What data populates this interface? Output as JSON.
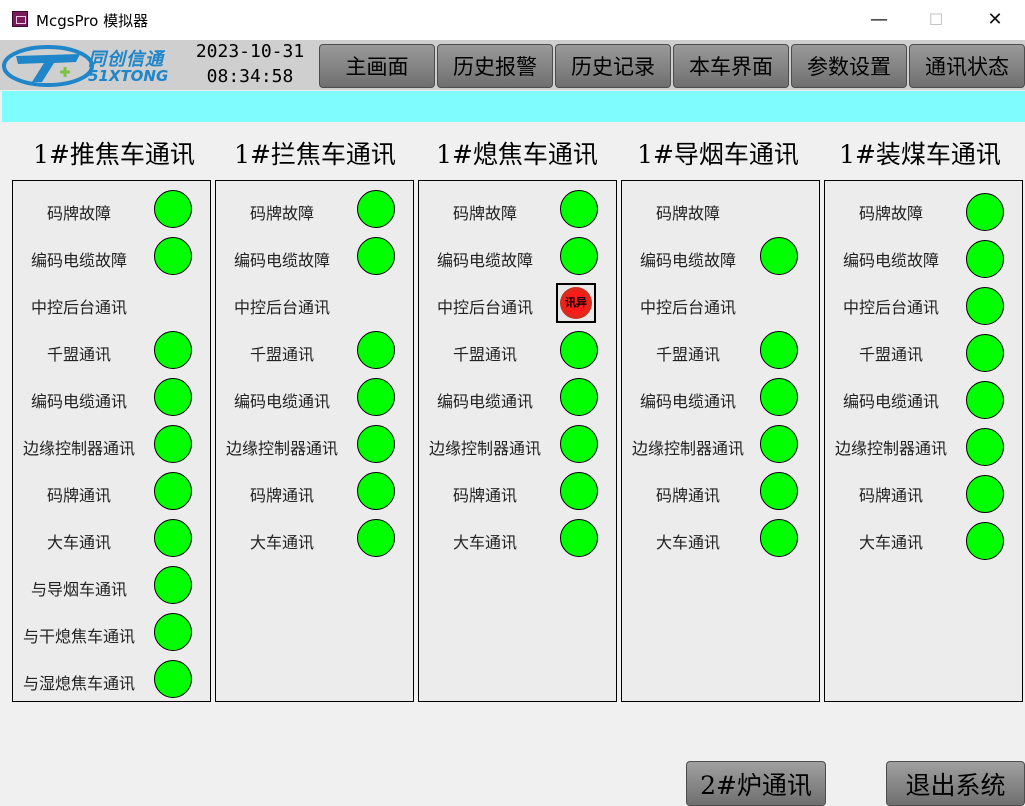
{
  "window": {
    "title": "McgsPro 模拟器",
    "min": "—",
    "max": "☐",
    "close": "✕"
  },
  "header": {
    "logo_cn": "同创信通",
    "logo_en": "51XTONG",
    "date": "2023-10-31",
    "time": "08:34:58",
    "nav": [
      "主画面",
      "历史报警",
      "历史记录",
      "本车界面",
      "参数设置",
      "通讯状态"
    ]
  },
  "sections": [
    {
      "title": "1#推焦车通讯",
      "rows": [
        {
          "label": "码牌故障",
          "status": "ok"
        },
        {
          "label": "编码电缆故障",
          "status": "ok"
        },
        {
          "label": "中控后台通讯",
          "status": "none"
        },
        {
          "label": "千盟通讯",
          "status": "ok"
        },
        {
          "label": "编码电缆通讯",
          "status": "ok"
        },
        {
          "label": "边缘控制器通讯",
          "status": "ok"
        },
        {
          "label": "码牌通讯",
          "status": "ok"
        },
        {
          "label": "大车通讯",
          "status": "ok"
        },
        {
          "label": "与导烟车通讯",
          "status": "ok"
        },
        {
          "label": "与干熄焦车通讯",
          "status": "ok"
        },
        {
          "label": "与湿熄焦车通讯",
          "status": "ok"
        }
      ]
    },
    {
      "title": "1#拦焦车通讯",
      "rows": [
        {
          "label": "码牌故障",
          "status": "ok"
        },
        {
          "label": "编码电缆故障",
          "status": "ok"
        },
        {
          "label": "中控后台通讯",
          "status": "none"
        },
        {
          "label": "千盟通讯",
          "status": "ok"
        },
        {
          "label": "编码电缆通讯",
          "status": "ok"
        },
        {
          "label": "边缘控制器通讯",
          "status": "ok"
        },
        {
          "label": "码牌通讯",
          "status": "ok"
        },
        {
          "label": "大车通讯",
          "status": "ok"
        }
      ]
    },
    {
      "title": "1#熄焦车通讯",
      "rows": [
        {
          "label": "码牌故障",
          "status": "ok"
        },
        {
          "label": "编码电缆故障",
          "status": "ok"
        },
        {
          "label": "中控后台通讯",
          "status": "alarm",
          "alarm_text": "讯异"
        },
        {
          "label": "千盟通讯",
          "status": "ok"
        },
        {
          "label": "编码电缆通讯",
          "status": "ok"
        },
        {
          "label": "边缘控制器通讯",
          "status": "ok"
        },
        {
          "label": "码牌通讯",
          "status": "ok"
        },
        {
          "label": "大车通讯",
          "status": "ok"
        }
      ]
    },
    {
      "title": "1#导烟车通讯",
      "rows": [
        {
          "label": "码牌故障",
          "status": "none"
        },
        {
          "label": "编码电缆故障",
          "status": "ok"
        },
        {
          "label": "中控后台通讯",
          "status": "none"
        },
        {
          "label": "千盟通讯",
          "status": "ok"
        },
        {
          "label": "编码电缆通讯",
          "status": "ok"
        },
        {
          "label": "边缘控制器通讯",
          "status": "ok"
        },
        {
          "label": "码牌通讯",
          "status": "ok"
        },
        {
          "label": "大车通讯",
          "status": "ok"
        }
      ]
    },
    {
      "title": "1#装煤车通讯",
      "rows": [
        {
          "label": "码牌故障",
          "status": "ok"
        },
        {
          "label": "编码电缆故障",
          "status": "ok"
        },
        {
          "label": "中控后台通讯",
          "status": "ok"
        },
        {
          "label": "千盟通讯",
          "status": "ok"
        },
        {
          "label": "编码电缆通讯",
          "status": "ok"
        },
        {
          "label": "边缘控制器通讯",
          "status": "ok"
        },
        {
          "label": "码牌通讯",
          "status": "ok"
        },
        {
          "label": "大车通讯",
          "status": "ok"
        }
      ]
    }
  ],
  "footer": {
    "furnace2": "2#炉通讯",
    "exit": "退出系统"
  },
  "colors": {
    "ok": "#00ff00",
    "banner": "#7ffcfd",
    "alarm": "#ff1a1a"
  }
}
